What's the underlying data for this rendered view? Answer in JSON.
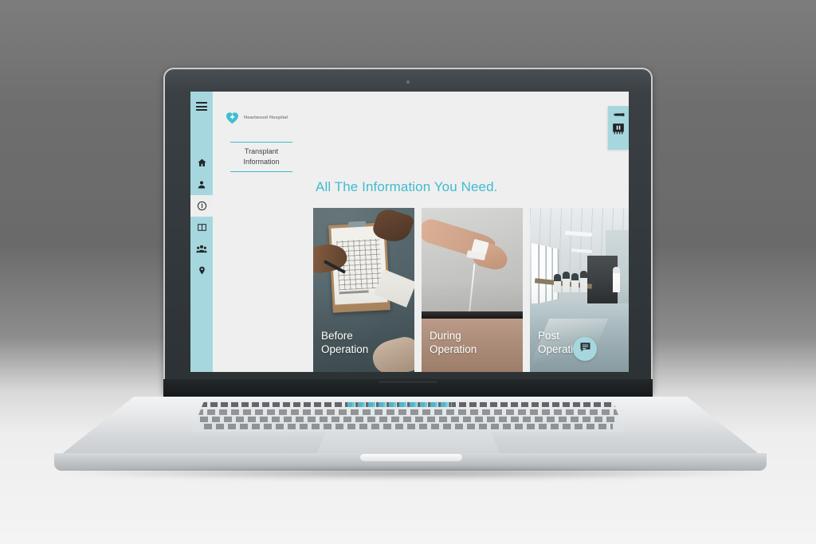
{
  "device": {
    "type": "laptop-mockup",
    "frame_color": "#343a3e",
    "body_color": "#d7dadd"
  },
  "theme": {
    "accent_teal": "#41bcd0",
    "sidebar_teal": "#a7d7de",
    "page_bg": "#efefef",
    "text_dark": "#3d4245",
    "caption_white": "#fefefe"
  },
  "app": {
    "brand": {
      "logo_icon": "heart-plus-icon",
      "name": "Heartwood Hospital"
    },
    "menu_button": {
      "icon": "hamburger-menu-icon",
      "label": "Menu"
    },
    "sidebar": {
      "items": [
        {
          "icon": "home-icon",
          "label": "Home",
          "active": false
        },
        {
          "icon": "person-icon",
          "label": "Patients",
          "active": false
        },
        {
          "icon": "info-icon",
          "label": "Information",
          "active": true
        },
        {
          "icon": "book-icon",
          "label": "Resources",
          "active": false
        },
        {
          "icon": "people-icon",
          "label": "Community",
          "active": false
        },
        {
          "icon": "location-pin-icon",
          "label": "Locations",
          "active": false
        }
      ]
    },
    "page_tab": {
      "line1": "Transplant",
      "line2": "Information"
    },
    "headline": "All The Information You Need.",
    "cards": [
      {
        "caption_line1": "Before",
        "caption_line2": "Operation",
        "image_alt": "clipboard-with-medical-chart-and-hands"
      },
      {
        "caption_line1": "During",
        "caption_line2": "Operation",
        "image_alt": "patient-hand-with-iv-drip-on-bed"
      },
      {
        "caption_line1": "Post",
        "caption_line2": "Operation",
        "image_alt": "hospital-corridor-with-waiting-people"
      }
    ],
    "ribbon": {
      "items": [
        {
          "icon": "pencil-icon",
          "label": "Edit"
        },
        {
          "icon": "bookmark-icon",
          "label": "Bookmark"
        }
      ]
    },
    "chat_button": {
      "icon": "chat-bubble-icon",
      "label": "Chat"
    }
  }
}
